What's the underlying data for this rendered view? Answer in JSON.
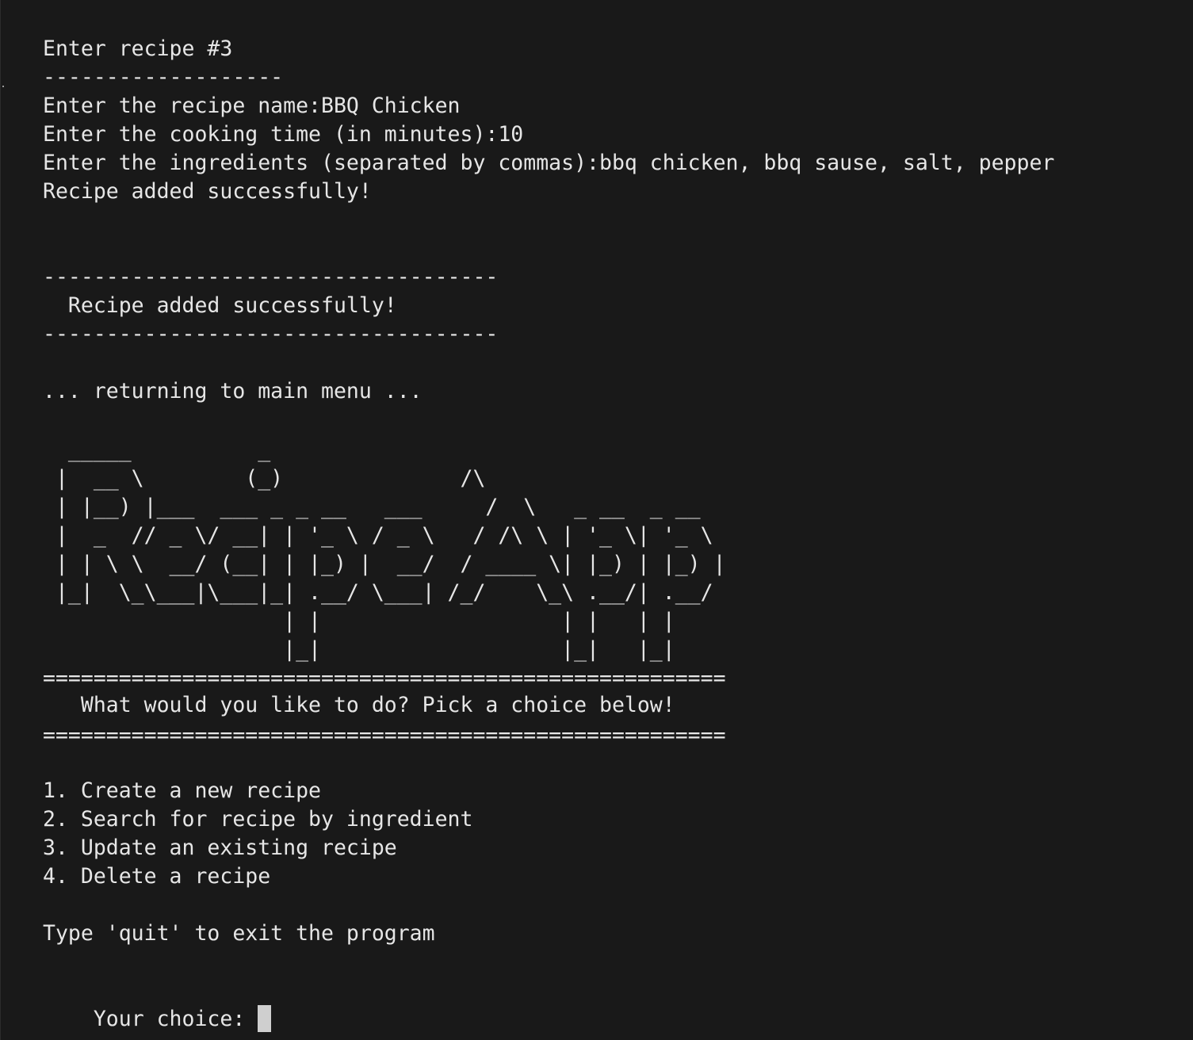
{
  "header": {
    "recipe_heading": "Enter recipe #3",
    "heading_rule": "-------------------"
  },
  "prompts": {
    "name": "Enter the recipe name:BBQ Chicken",
    "time": "Enter the cooking time (in minutes):10",
    "ingredients": "Enter the ingredients (separated by commas):bbq chicken, bbq sause, salt, pepper",
    "added": "Recipe added successfully!"
  },
  "banner": {
    "rule": "------------------------------------",
    "message": "  Recipe added successfully!"
  },
  "returning": "... returning to main menu ...",
  "logo": {
    "lines": [
      "  _____          _",
      " |  __ \\        (_)              /\\",
      " | |__) |___  ___ _ _ __   ___     /  \\   _ __  _ __",
      " |  _  // _ \\/ __| | '_ \\ / _ \\   / /\\ \\ | '_ \\| '_ \\",
      " | | \\ \\  __/ (__| | |_) |  __/  / ____ \\| |_) | |_) |",
      " |_|  \\_\\___|\\___|_| .__/ \\___| /_/    \\_\\ .__/| .__/",
      "                   | |                   | |   | |",
      "                   |_|                   |_|   |_|"
    ]
  },
  "menu": {
    "rule": "======================================================",
    "prompt": "   What would you like to do? Pick a choice below!",
    "items": [
      "1. Create a new recipe",
      "2. Search for recipe by ingredient",
      "3. Update an existing recipe",
      "4. Delete a recipe"
    ],
    "quit_hint": "Type 'quit' to exit the program",
    "choice_label": "Your choice: "
  }
}
